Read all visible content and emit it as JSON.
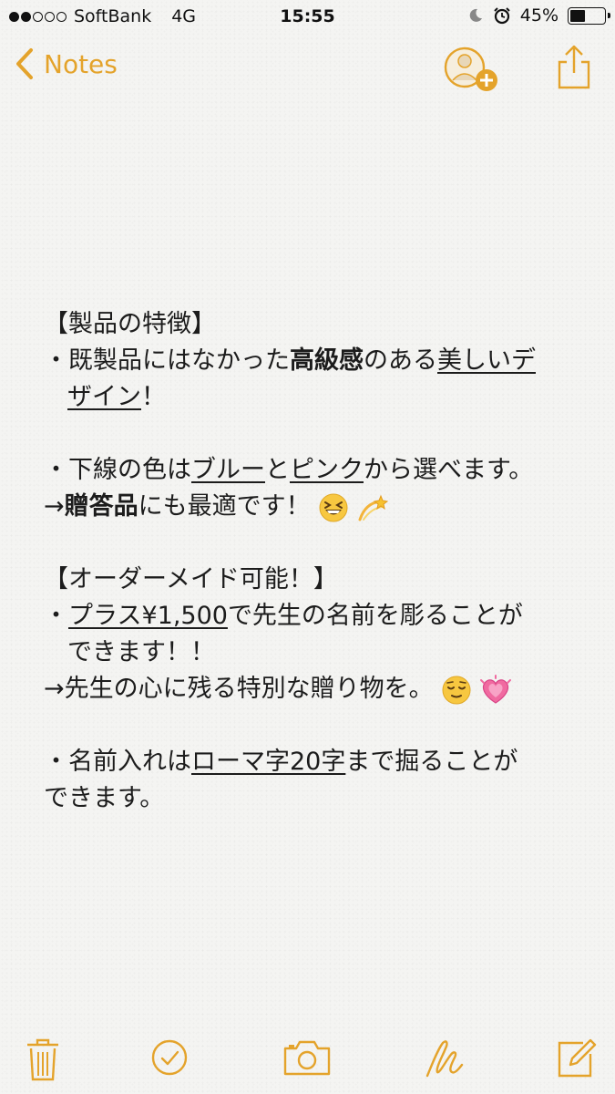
{
  "status_bar": {
    "carrier": "SoftBank",
    "network": "4G",
    "time": "15:55",
    "battery_percent": "45%",
    "battery_level": 0.45
  },
  "nav": {
    "back_label": "Notes",
    "icons": [
      "chevron-left-icon",
      "add-person-icon",
      "share-icon"
    ]
  },
  "note": {
    "section1_title": "【製品の特徴】",
    "p1_prefix": "・既製品にはなかった",
    "p1_bold": "高級感",
    "p1_mid": "のある",
    "p1_u1": "美しいデ",
    "p1_u2": "ザイン",
    "p1_suffix": "！",
    "p2_prefix": "・下線の色は",
    "p2_u1": "ブルー",
    "p2_mid": "と",
    "p2_u2": "ピンク",
    "p2_suffix": "から選べます。",
    "p3_prefix": "→",
    "p3_bold": "贈答品",
    "p3_suffix": "にも最適です！",
    "section2_title": "【オーダーメイド可能！】",
    "p4_prefix": "・",
    "p4_u": "プラス¥1,500",
    "p4_suffix": "で先生の名前を彫ることが",
    "p4_line2": "できます！！",
    "p5": "→先生の心に残る特別な贈り物を。",
    "p6_prefix": "・名前入れは",
    "p6_u": "ローマ字20字",
    "p6_suffix": "まで掘ることが",
    "p6_line2": "できます。"
  },
  "toolbar": {
    "icons": [
      "trash-icon",
      "checklist-icon",
      "camera-icon",
      "sketch-icon",
      "compose-icon"
    ]
  },
  "colors": {
    "accent": "#e4a32b",
    "text": "#1c1c1c",
    "background": "#f4f4f2"
  }
}
